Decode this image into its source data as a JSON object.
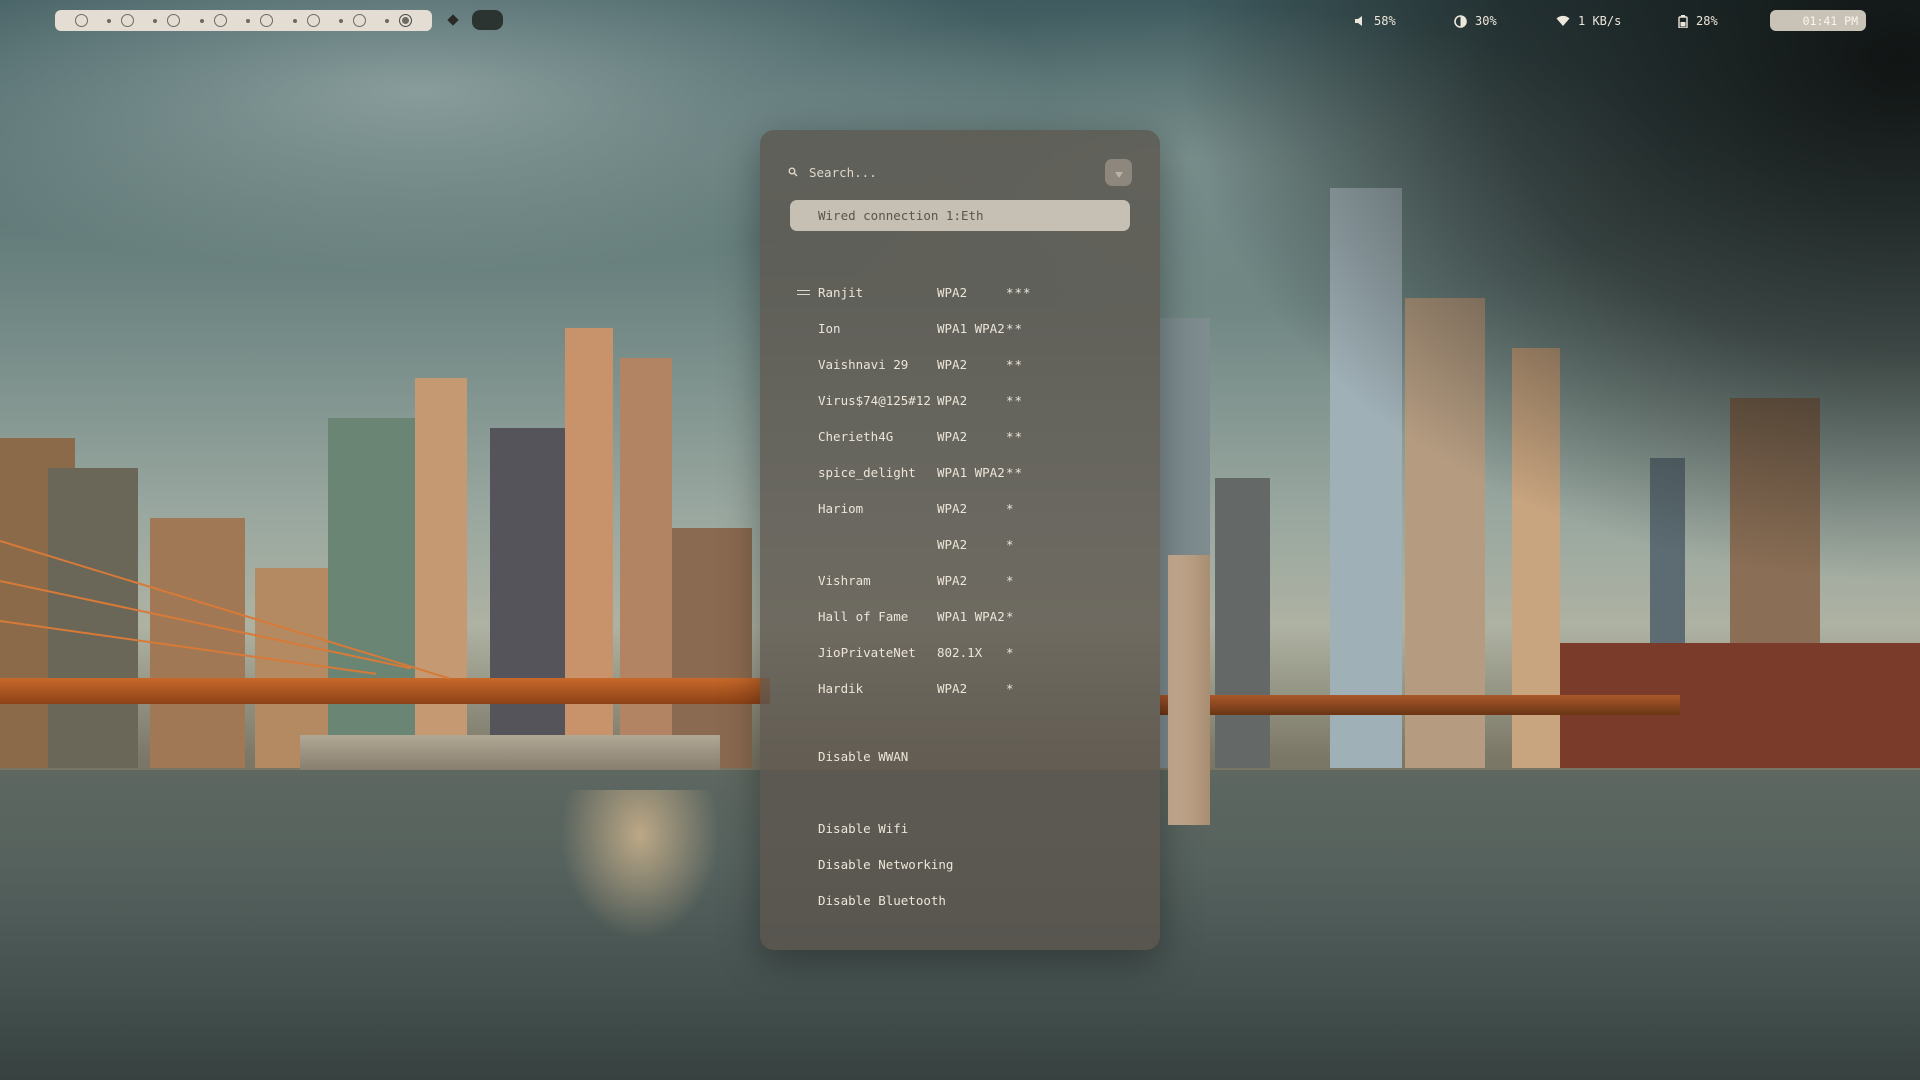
{
  "topbar": {
    "workspaces": [
      {
        "active": false
      },
      {
        "active": false
      },
      {
        "active": false
      },
      {
        "active": false
      },
      {
        "active": false
      },
      {
        "active": false
      },
      {
        "active": false
      },
      {
        "active": true
      }
    ],
    "volume": {
      "icon": "speaker-icon",
      "value": "58%"
    },
    "brightness": {
      "icon": "brightness-icon",
      "value": "30%"
    },
    "network": {
      "icon": "wifi-icon",
      "value": "1 KB/s"
    },
    "battery": {
      "icon": "battery-icon",
      "value": "28%"
    },
    "clock": "01:41 PM"
  },
  "menu": {
    "search_placeholder": "Search...",
    "selected_entry": "Wired connection 1:Eth",
    "networks": [
      {
        "ssid": "Ranjit",
        "security": "WPA2",
        "signal": "***",
        "connected": true
      },
      {
        "ssid": "Ion",
        "security": "WPA1 WPA2",
        "signal": "**",
        "connected": false
      },
      {
        "ssid": "Vaishnavi 29",
        "security": "WPA2",
        "signal": "**",
        "connected": false
      },
      {
        "ssid": "Virus$74@125#12",
        "security": "WPA2",
        "signal": "**",
        "connected": false
      },
      {
        "ssid": "Cherieth4G",
        "security": "WPA2",
        "signal": "**",
        "connected": false
      },
      {
        "ssid": "spice_delight",
        "security": "WPA1 WPA2",
        "signal": "**",
        "connected": false
      },
      {
        "ssid": "Hariom",
        "security": "WPA2",
        "signal": "*",
        "connected": false
      },
      {
        "ssid": "",
        "security": "WPA2",
        "signal": "*",
        "connected": false
      },
      {
        "ssid": "Vishram",
        "security": "WPA2",
        "signal": "*",
        "connected": false
      },
      {
        "ssid": "Hall of Fame",
        "security": "WPA1 WPA2",
        "signal": "*",
        "connected": false
      },
      {
        "ssid": "JioPrivateNet",
        "security": "802.1X",
        "signal": "*",
        "connected": false
      },
      {
        "ssid": "Hardik",
        "security": "WPA2",
        "signal": "*",
        "connected": false
      }
    ],
    "actions": {
      "disable_wwan": "Disable WWAN",
      "disable_wifi": "Disable Wifi",
      "disable_networking": "Disable Networking",
      "disable_bluetooth": "Disable Bluetooth"
    }
  },
  "colors": {
    "panel_bg": "#5c564e",
    "selected_bg": "#c6bfb3",
    "text": "#ece5d8",
    "topbar_pill": "#e3ddd4"
  }
}
